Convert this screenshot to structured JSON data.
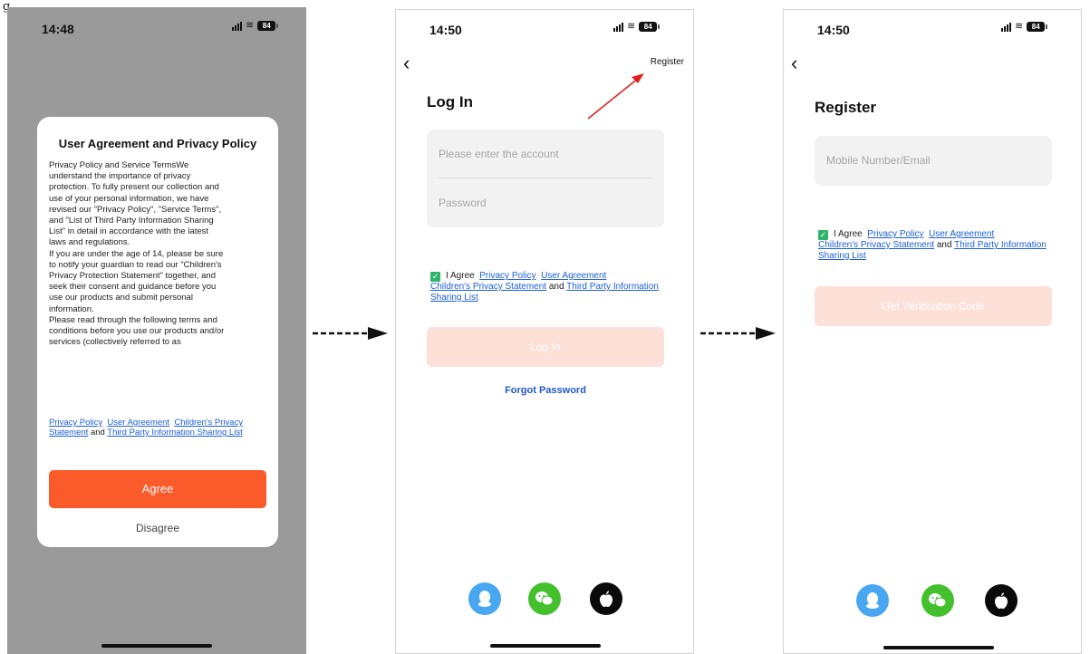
{
  "figure_label": "g.",
  "status": {
    "time_1": "14:48",
    "time_2": "14:50",
    "time_3": "14:50",
    "battery": "84"
  },
  "dialog": {
    "title": "User Agreement and Privacy Policy",
    "body": [
      "Privacy Policy and Service TermsWe",
      "understand the importance of privacy",
      "protection. To fully present our collection and",
      "use of your personal information, we have",
      "revised our \"Privacy Policy\", \"Service Terms\",",
      "and \"List of Third Party Information Sharing",
      "List\" in detail in accordance with the latest",
      "laws and regulations.",
      "If you are under the age of 14, please be sure",
      "to notify your guardian to read our \"Children's",
      "Privacy Protection Statement\" together, and",
      "seek their consent and guidance before you",
      "use our products and submit personal",
      "information.",
      "Please read through the following terms and",
      "conditions before you use our products and/or",
      "services (collectively referred to as"
    ],
    "links": {
      "privacy_policy": "Privacy Policy",
      "user_agreement": "User Agreement",
      "childrens_statement": "Children's Privacy Statement",
      "and": "and",
      "third_party": "Third Party Information Sharing List"
    },
    "agree_label": "Agree",
    "disagree_label": "Disagree"
  },
  "login": {
    "register_label": "Register",
    "title": "Log In",
    "account_placeholder": "Please enter the account",
    "password_placeholder": "Password",
    "agree_prefix": "I Agree",
    "privacy_policy": "Privacy Policy",
    "user_agreement": "User Agreement",
    "childrens_statement": "Children's Privacy Statement",
    "and": "and",
    "third_party": "Third Party Information Sharing List",
    "login_button": "Log In",
    "forgot_password": "Forgot Password"
  },
  "register": {
    "title": "Register",
    "mobile_placeholder": "Mobile Number/Email",
    "agree_prefix": "I Agree",
    "privacy_policy": "Privacy Policy",
    "user_agreement": "User Agreement",
    "childrens_statement": "Children's Privacy Statement",
    "and": "and",
    "third_party": "Third Party Information Sharing List",
    "verify_button": "Get Verification Code"
  },
  "icons": [
    "back-arrow-icon",
    "qq-icon",
    "wechat-icon",
    "apple-icon",
    "checkbox-checked-icon"
  ],
  "colors": {
    "accent": "#fb5a2a",
    "link": "#1b5fd6",
    "check": "#2fb56b",
    "annotation_arrow": "#e02020"
  }
}
